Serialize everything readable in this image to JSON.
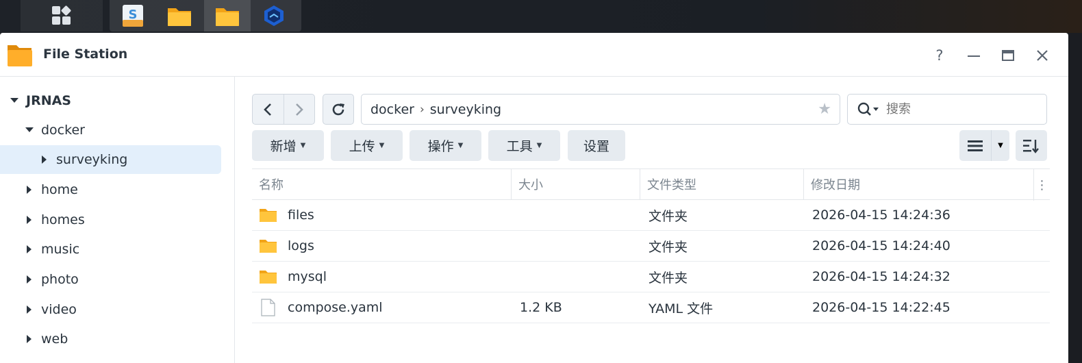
{
  "taskbar": {
    "main_icon": "apps-grid-icon",
    "apps": [
      {
        "name": "text-editor-app-icon",
        "active": false
      },
      {
        "name": "folder-app-icon",
        "active": false
      },
      {
        "name": "folder-app-icon",
        "active": true
      },
      {
        "name": "hyper-backup-app-icon",
        "active": false
      }
    ]
  },
  "window": {
    "title": "File Station",
    "controls": {
      "help": "?",
      "minimize": "—",
      "maximize": "▭",
      "close": "✕"
    }
  },
  "sidebar": {
    "root": "JRNAS",
    "items": [
      {
        "label": "docker",
        "level": 1,
        "expanded": true
      },
      {
        "label": "surveyking",
        "level": 2,
        "expanded": false,
        "selected": true
      },
      {
        "label": "home",
        "level": 1,
        "expanded": false
      },
      {
        "label": "homes",
        "level": 1,
        "expanded": false
      },
      {
        "label": "music",
        "level": 1,
        "expanded": false
      },
      {
        "label": "photo",
        "level": 1,
        "expanded": false
      },
      {
        "label": "video",
        "level": 1,
        "expanded": false
      },
      {
        "label": "web",
        "level": 1,
        "expanded": false
      }
    ]
  },
  "toolbar": {
    "path": [
      "docker",
      "surveyking"
    ],
    "path_sep": "›",
    "search_placeholder": "搜索",
    "buttons": {
      "create": "新增",
      "upload": "上传",
      "action": "操作",
      "tools": "工具",
      "settings": "设置"
    }
  },
  "table": {
    "headers": {
      "name": "名称",
      "size": "大小",
      "type": "文件类型",
      "modified": "修改日期"
    },
    "rows": [
      {
        "name": "files",
        "size": "",
        "type": "文件夹",
        "modified": "2026-04-15 14:24:36",
        "icon": "folder-icon"
      },
      {
        "name": "logs",
        "size": "",
        "type": "文件夹",
        "modified": "2026-04-15 14:24:40",
        "icon": "folder-icon"
      },
      {
        "name": "mysql",
        "size": "",
        "type": "文件夹",
        "modified": "2026-04-15 14:24:32",
        "icon": "folder-icon"
      },
      {
        "name": "compose.yaml",
        "size": "1.2 KB",
        "type": "YAML 文件",
        "modified": "2026-04-15 14:22:45",
        "icon": "file-icon"
      }
    ]
  },
  "colors": {
    "folder": "#f7b52c",
    "selection": "#e3effb",
    "accent_button": "#e6ebf0"
  }
}
